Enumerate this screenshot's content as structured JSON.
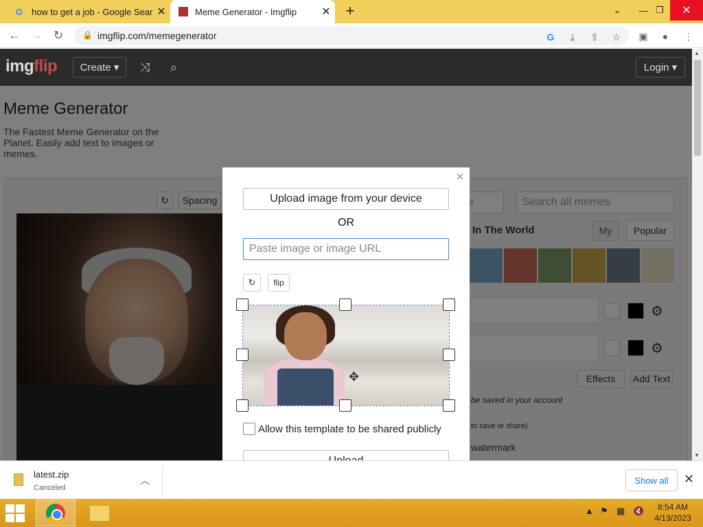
{
  "browser": {
    "tabs": [
      {
        "title": "how to get a job - Google Search",
        "favicon": "google-g-icon"
      },
      {
        "title": "Meme Generator - Imgflip",
        "favicon": "imgflip-icon"
      }
    ],
    "url": "imgflip.com/memegenerator"
  },
  "site": {
    "logo_main": "img",
    "logo_accent": "flip",
    "create_label": "Create ▾",
    "login_label": "Login ▾"
  },
  "page": {
    "title": "Meme Generator",
    "description": "The Fastest Meme Generator on the Planet. Easily add text to images or memes.",
    "spacing_label": "Spacing",
    "search_placeholder": "Search all memes",
    "partial_input": "e",
    "tab_world": "In The World",
    "tab_my": "My",
    "tab_popular": "Popular",
    "effects_label": "Effects",
    "add_text_label": "Add Text",
    "saved_note": "be saved in your account",
    "save_share_note": "to save or share)",
    "watermark_label": "watermark"
  },
  "modal": {
    "upload_device_label": "Upload image from your device",
    "or_label": "OR",
    "url_placeholder": "Paste image or image URL",
    "flip_label": "flip",
    "share_label": "Allow this template to be shared publicly",
    "upload_label": "Upload"
  },
  "downloads": {
    "file_name": "latest.zip",
    "status": "Canceled",
    "show_all_label": "Show all"
  },
  "taskbar": {
    "time": "8:54 AM",
    "date": "4/13/2023"
  },
  "colors": {
    "tabstrip": "#f1cf5a",
    "taskbar": "#e2a020",
    "accent_blue": "#1a73e8",
    "close_red": "#e81123"
  }
}
